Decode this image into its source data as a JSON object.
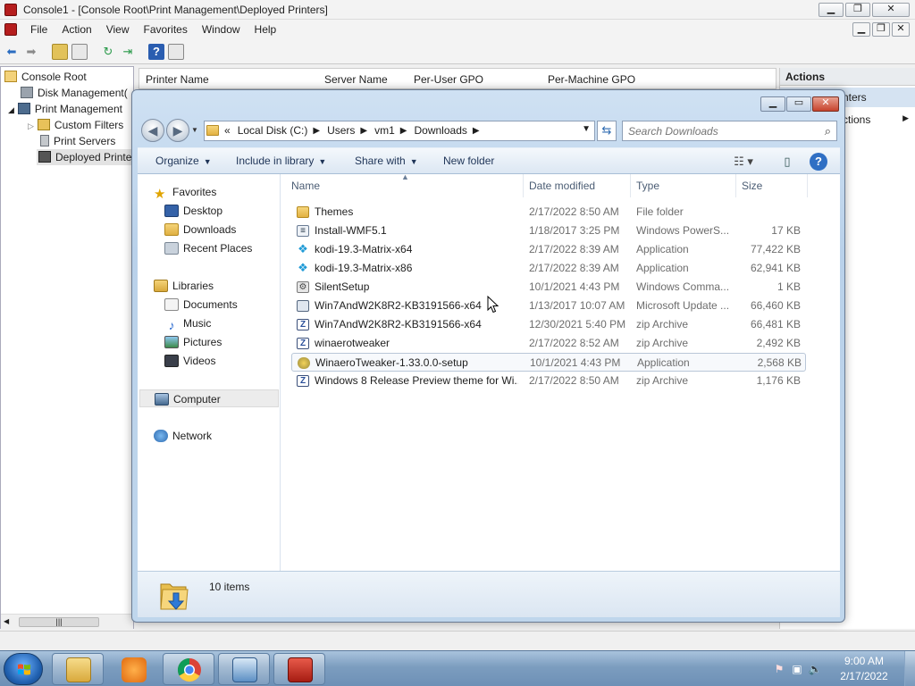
{
  "mmc": {
    "title": "Console1 - [Console Root\\Print Management\\Deployed Printers]",
    "menu": [
      "File",
      "Action",
      "View",
      "Favorites",
      "Window",
      "Help"
    ],
    "tree": [
      "Console Root",
      "Disk Management(",
      "Print Management",
      "Custom Filters",
      "Print Servers",
      "Deployed Printe"
    ],
    "columns": [
      "Printer Name",
      "Server Name",
      "Per-User GPO",
      "Per-Machine GPO"
    ],
    "actions": {
      "header": "Actions",
      "row1": "nters",
      "row2": "ctions"
    }
  },
  "explorer": {
    "breadcrumb": {
      "root_marker": "«",
      "parts": [
        "Local Disk (C:)",
        "Users",
        "vm1",
        "Downloads"
      ]
    },
    "search_placeholder": "Search Downloads",
    "commands": [
      "Organize",
      "Include in library",
      "Share with",
      "New folder"
    ],
    "nav": {
      "favorites": "Favorites",
      "favorites_items": [
        "Desktop",
        "Downloads",
        "Recent Places"
      ],
      "libraries": "Libraries",
      "libraries_items": [
        "Documents",
        "Music",
        "Pictures",
        "Videos"
      ],
      "computer": "Computer",
      "network": "Network"
    },
    "columns": {
      "name": "Name",
      "date": "Date modified",
      "type": "Type",
      "size": "Size"
    },
    "files": [
      {
        "name": "Themes",
        "date": "2/17/2022 8:50 AM",
        "type": "File folder",
        "size": "",
        "icon": "folder-icon"
      },
      {
        "name": "Install-WMF5.1",
        "date": "1/18/2017 3:25 PM",
        "type": "Windows PowerS...",
        "size": "17 KB",
        "icon": "powershell-script-icon"
      },
      {
        "name": "kodi-19.3-Matrix-x64",
        "date": "2/17/2022 8:39 AM",
        "type": "Application",
        "size": "77,422 KB",
        "icon": "kodi-icon"
      },
      {
        "name": "kodi-19.3-Matrix-x86",
        "date": "2/17/2022 8:39 AM",
        "type": "Application",
        "size": "62,941 KB",
        "icon": "kodi-icon"
      },
      {
        "name": "SilentSetup",
        "date": "10/1/2021 4:43 PM",
        "type": "Windows Comma...",
        "size": "1 KB",
        "icon": "batch-file-icon"
      },
      {
        "name": "Win7AndW2K8R2-KB3191566-x64",
        "date": "1/13/2017 10:07 AM",
        "type": "Microsoft Update ...",
        "size": "66,460 KB",
        "icon": "update-package-icon"
      },
      {
        "name": "Win7AndW2K8R2-KB3191566-x64",
        "date": "12/30/2021 5:40 PM",
        "type": "zip Archive",
        "size": "66,481 KB",
        "icon": "zip-icon"
      },
      {
        "name": "winaerotweaker",
        "date": "2/17/2022 8:52 AM",
        "type": "zip Archive",
        "size": "2,492 KB",
        "icon": "zip-icon"
      },
      {
        "name": "WinaeroTweaker-1.33.0.0-setup",
        "date": "10/1/2021 4:43 PM",
        "type": "Application",
        "size": "2,568 KB",
        "icon": "setup-icon"
      },
      {
        "name": "Windows 8 Release Preview theme for Wi...",
        "date": "2/17/2022 8:50 AM",
        "type": "zip Archive",
        "size": "1,176 KB",
        "icon": "zip-icon"
      }
    ],
    "selected_index": 8,
    "item_count": "10 items"
  },
  "taskbar": {
    "time": "9:00 AM",
    "date": "2/17/2022",
    "apps": [
      "windows-explorer-icon",
      "media-player-icon",
      "chrome-icon",
      "remote-desktop-icon",
      "toolbox-icon"
    ]
  }
}
